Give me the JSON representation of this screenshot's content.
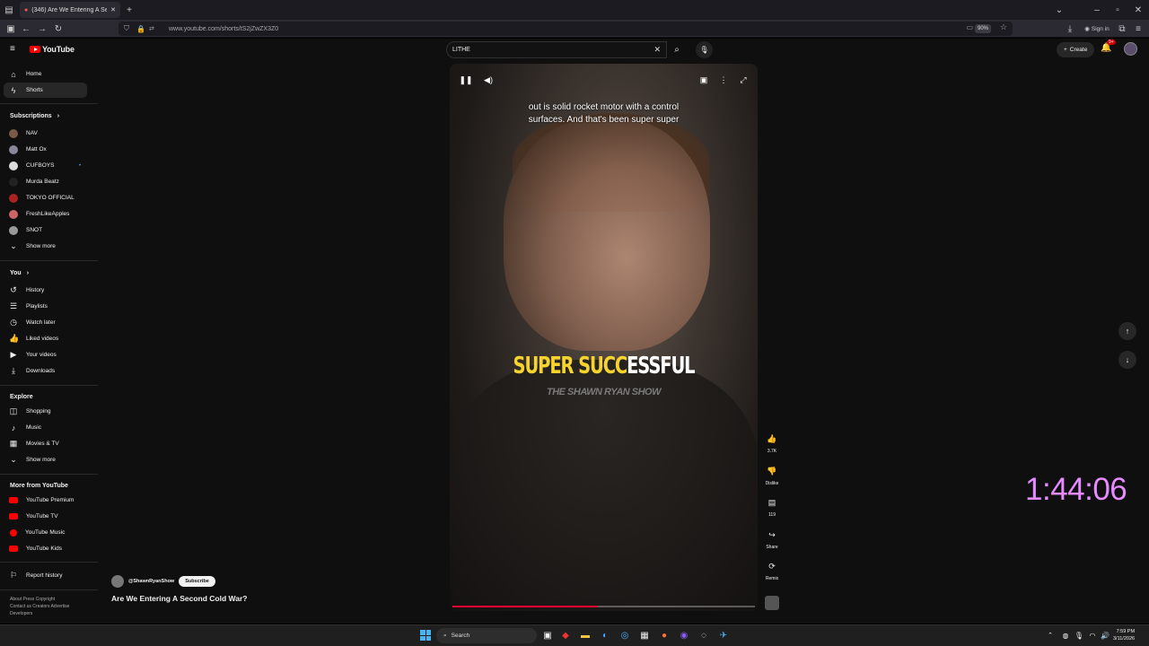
{
  "browser": {
    "tab_title": "(346) Are We Entering A Se",
    "url": "www.youtube.com/shorts/tS2jZwZX3Z0",
    "zoom": "90%",
    "sign_in": "Sign in"
  },
  "masthead": {
    "logo": "YouTube",
    "search_value": "LITHE",
    "create_label": "Create",
    "notif_badge": "9+"
  },
  "sidebar": {
    "home": "Home",
    "shorts": "Shorts",
    "subscriptions_heading": "Subscriptions",
    "subscriptions": [
      "NAV",
      "Matt Ox",
      "CUFBOYS",
      "Murda Beatz",
      "TOKYO OFFICIAL",
      "FreshLikeApples",
      "SNOT"
    ],
    "show_more": "Show more",
    "you_heading": "You",
    "you_items": [
      "History",
      "Playlists",
      "Watch later",
      "Liked videos",
      "Your videos",
      "Downloads"
    ],
    "explore_heading": "Explore",
    "explore_items": [
      "Shopping",
      "Music",
      "Movies & TV"
    ],
    "explore_show_more": "Show more",
    "more_heading": "More from YouTube",
    "more_items": [
      "YouTube Premium",
      "YouTube TV",
      "YouTube Music",
      "YouTube Kids"
    ],
    "report_history": "Report history",
    "footer_line1": "About  Press  Copyright",
    "footer_line2": "Contact us  Creators  Advertise",
    "footer_line3": "Developers"
  },
  "video": {
    "caption_line1": "out is solid rocket motor with a control",
    "caption_line2": "surfaces. And that's been super super",
    "overlay_yellow": "SUPER SUCC",
    "overlay_white": "ESSFUL",
    "show_name": "THE SHAWN RYAN SHOW",
    "progress": 0.48
  },
  "actions": {
    "like_count": "3.7K",
    "dislike_label": "Dislike",
    "comment_count": "119",
    "share_label": "Share",
    "remix_label": "Remix"
  },
  "channel": {
    "handle": "@ShawnRyanShow",
    "subscribe_label": "Subscribe",
    "video_title": "Are We Entering A Second Cold War?"
  },
  "overlay_clock": "1:44:06",
  "taskbar": {
    "search_label": "Search",
    "time": "7:59 PM",
    "date": "3/11/2026"
  }
}
